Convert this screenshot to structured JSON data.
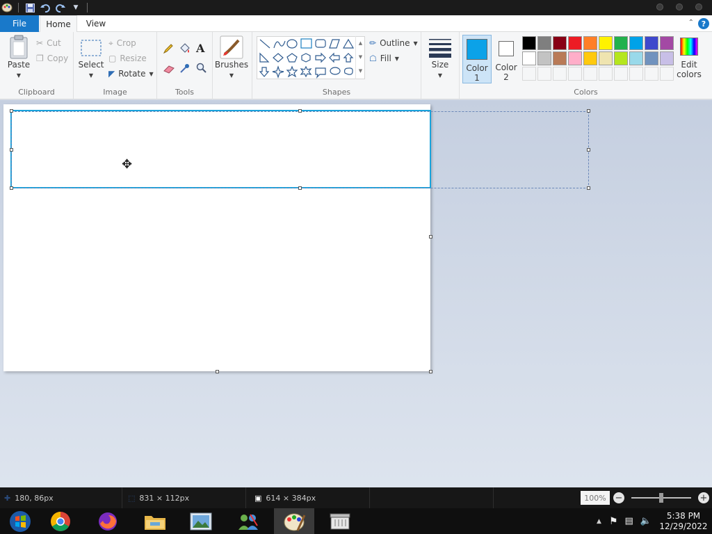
{
  "quick_access": {
    "icons": [
      "paint-app-icon",
      "save-icon",
      "undo-icon",
      "redo-icon",
      "customize-dropdown-icon"
    ]
  },
  "tabs": {
    "file": "File",
    "home": "Home",
    "view": "View"
  },
  "clipboard": {
    "paste": "Paste",
    "cut": "Cut",
    "copy": "Copy",
    "group": "Clipboard"
  },
  "image": {
    "select": "Select",
    "crop": "Crop",
    "resize": "Resize",
    "rotate": "Rotate",
    "group": "Image"
  },
  "tools": {
    "group": "Tools"
  },
  "brushes": {
    "label": "Brushes"
  },
  "shapes": {
    "outline": "Outline",
    "fill": "Fill",
    "group": "Shapes"
  },
  "size": {
    "label": "Size"
  },
  "colors": {
    "color1_label": "Color",
    "color1_num": "1",
    "color2_label": "Color",
    "color2_num": "2",
    "edit_label": "Edit",
    "edit_label2": "colors",
    "group": "Colors",
    "color1": "#0ba2e8",
    "color2": "#ffffff",
    "palette_row1": [
      "#000000",
      "#7f7f7f",
      "#880015",
      "#ed1c24",
      "#ff7f27",
      "#fff200",
      "#22b14c",
      "#00a2e8",
      "#3f48cc",
      "#a349a4"
    ],
    "palette_row2": [
      "#ffffff",
      "#c3c3c3",
      "#b97a57",
      "#ffaec9",
      "#ffc90e",
      "#efe4b0",
      "#b5e61d",
      "#99d9ea",
      "#7092be",
      "#c8bfe7"
    ],
    "palette_row3": [
      "#f5f6f7",
      "#f5f6f7",
      "#f5f6f7",
      "#f5f6f7",
      "#f5f6f7",
      "#f5f6f7",
      "#f5f6f7",
      "#f5f6f7",
      "#f5f6f7",
      "#f5f6f7"
    ]
  },
  "status": {
    "cursor_pos": "180, 86px",
    "selection_size": "831 × 112px",
    "image_size": "614 × 384px",
    "zoom": "100%",
    "zoom_level": 0.5
  },
  "taskbar": {
    "apps": [
      "windows-logo-icon",
      "chrome-icon",
      "firefox-icon",
      "file-explorer-icon",
      "photo-viewer-icon",
      "network-people-icon",
      "paint-icon",
      "archive-icon"
    ],
    "time": "5:38 PM",
    "date": "12/29/2022"
  }
}
